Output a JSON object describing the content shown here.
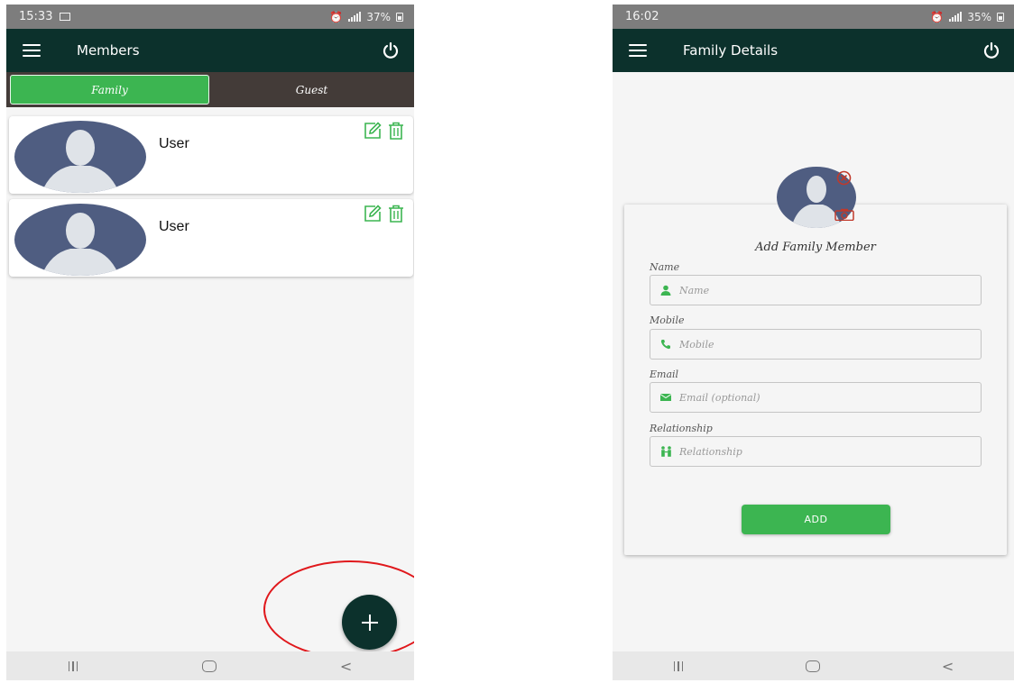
{
  "left_screen": {
    "status": {
      "time": "15:33",
      "battery": "37%"
    },
    "appbar": {
      "title": "Members"
    },
    "tabs": [
      {
        "label": "Family",
        "active": true
      },
      {
        "label": "Guest",
        "active": false
      }
    ],
    "members": [
      {
        "name": "User"
      },
      {
        "name": "User"
      }
    ]
  },
  "right_screen": {
    "status": {
      "time": "16:02",
      "battery": "35%"
    },
    "appbar": {
      "title": "Family Details"
    },
    "form": {
      "title": "Add Family Member",
      "fields": [
        {
          "label": "Name",
          "placeholder": "Name",
          "icon": "person-icon"
        },
        {
          "label": "Mobile",
          "placeholder": "Mobile",
          "icon": "phone-icon"
        },
        {
          "label": "Email",
          "placeholder": "Email (optional)",
          "icon": "envelope-icon"
        },
        {
          "label": "Relationship",
          "placeholder": "Relationship",
          "icon": "family-icon"
        }
      ],
      "submit_label": "ADD"
    }
  },
  "colors": {
    "primary_dark": "#0c312c",
    "accent_green": "#3cb551",
    "avatar_blue": "#4f5d81",
    "highlight_red": "#e0181c"
  }
}
